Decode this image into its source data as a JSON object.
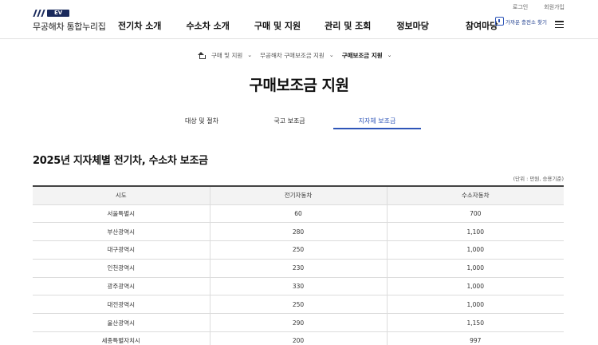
{
  "util": {
    "login": "로그인",
    "signup": "회원가입"
  },
  "logo": {
    "badge": "EV",
    "text": "무공해차 통합누리집"
  },
  "gnb": [
    "전기차 소개",
    "수소차 소개",
    "구매 및 지원",
    "관리 및 조회",
    "정보마당",
    "참여마당"
  ],
  "charger_button": "가까운 충전소 찾기",
  "breadcrumb": [
    "구매 및 지원",
    "무공해차 구매보조금 지원",
    "구매보조금 지원"
  ],
  "page_title": "구매보조금 지원",
  "tabs": [
    "대상 및 절차",
    "국고 보조금",
    "지자체 보조금"
  ],
  "active_tab": 2,
  "section_title": "2025년 지자체별 전기차, 수소차 보조금",
  "unit_note": "(단위 : 만원, 승용기준)",
  "table": {
    "headers": [
      "시도",
      "전기자동차",
      "수소자동차"
    ],
    "rows": [
      [
        "서울특별시",
        "60",
        "700"
      ],
      [
        "부산광역시",
        "280",
        "1,100"
      ],
      [
        "대구광역시",
        "250",
        "1,000"
      ],
      [
        "인천광역시",
        "230",
        "1,000"
      ],
      [
        "광주광역시",
        "330",
        "1,000"
      ],
      [
        "대전광역시",
        "250",
        "1,000"
      ],
      [
        "울산광역시",
        "290",
        "1,150"
      ],
      [
        "세종특별자치시",
        "200",
        "997"
      ]
    ]
  }
}
